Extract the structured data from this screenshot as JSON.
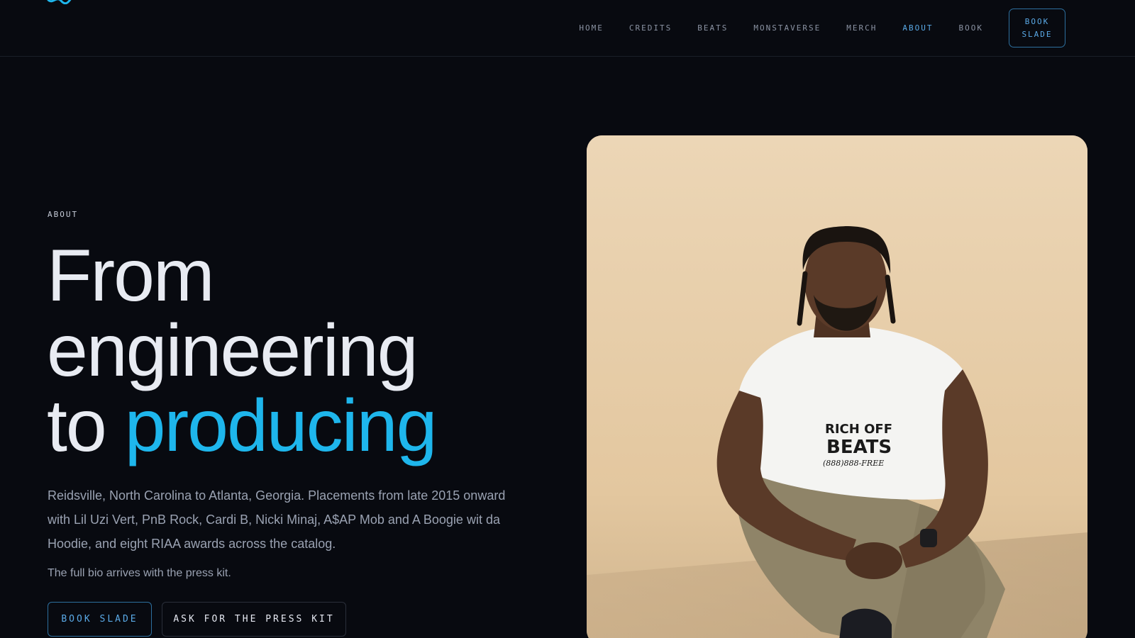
{
  "header": {
    "logo_icon": "brand-logo-icon",
    "nav": [
      {
        "label": "HOME",
        "active": false
      },
      {
        "label": "CREDITS",
        "active": false
      },
      {
        "label": "BEATS",
        "active": false
      },
      {
        "label": "MONSTAVERSE",
        "active": false
      },
      {
        "label": "MERCH",
        "active": false
      },
      {
        "label": "ABOUT",
        "active": true
      },
      {
        "label": "BOOK",
        "active": false
      }
    ],
    "cta": {
      "line1": "BOOK",
      "line2": "SLADE"
    }
  },
  "hero": {
    "eyebrow": "ABOUT",
    "headline": {
      "line1": "From",
      "line2": "engineering",
      "line3_plain": "to",
      "line3_accent": "producing"
    },
    "lede": "Reidsville, North Carolina to Atlanta, Georgia. Placements from late 2015 onward with Lil Uzi Vert, PnB Rock, Cardi B, Nicki Minaj, A$AP Mob and A Boogie wit da Hoodie, and eight RIAA awards across the catalog.",
    "note": "The full bio arrives with the press kit.",
    "primary_button": "BOOK SLADE",
    "secondary_button": "ASK FOR THE PRESS KIT"
  },
  "photo": {
    "shirt_line1": "RICH OFF",
    "shirt_line2": "BEATS",
    "shirt_line3": "(888)888-FREE"
  },
  "colors": {
    "background": "#080a10",
    "accent": "#1eb6ec",
    "nav_active": "#5aa9e6",
    "text_muted": "#9aa2b2"
  }
}
